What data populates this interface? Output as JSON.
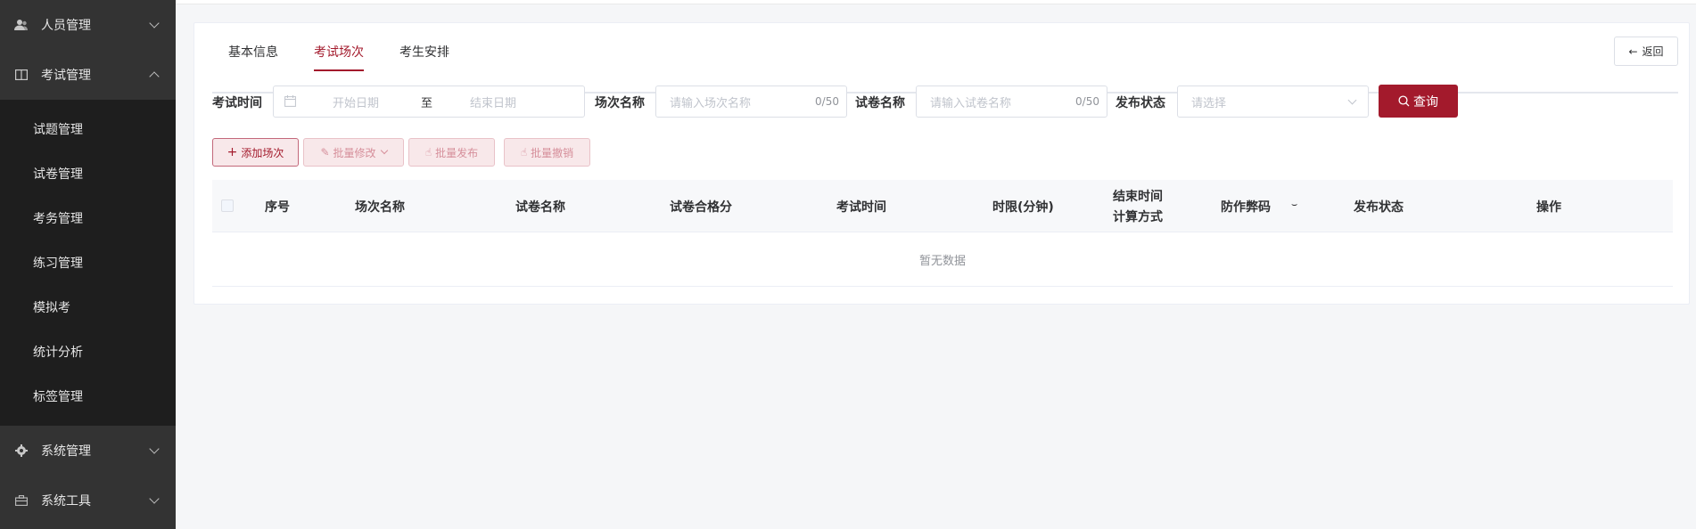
{
  "sidebar": {
    "menus": [
      {
        "label": "人员管理",
        "icon": "user-group-icon",
        "expanded": false
      },
      {
        "label": "考试管理",
        "icon": "book-icon",
        "expanded": true
      },
      {
        "label": "系统管理",
        "icon": "gear-icon",
        "expanded": false
      },
      {
        "label": "系统工具",
        "icon": "toolbox-icon",
        "expanded": false
      }
    ],
    "exam_submenu": [
      "试题管理",
      "试卷管理",
      "考务管理",
      "练习管理",
      "模拟考",
      "统计分析",
      "标签管理"
    ]
  },
  "tabs": [
    "基本信息",
    "考试场次",
    "考生安排"
  ],
  "active_tab": 1,
  "back_label": "返回",
  "filters": {
    "exam_time_label": "考试时间",
    "start_placeholder": "开始日期",
    "range_sep": "至",
    "end_placeholder": "结束日期",
    "session_name_label": "场次名称",
    "session_name_placeholder": "请输入场次名称",
    "session_name_count": "0/50",
    "paper_name_label": "试卷名称",
    "paper_name_placeholder": "请输入试卷名称",
    "paper_name_count": "0/50",
    "publish_status_label": "发布状态",
    "publish_status_placeholder": "请选择",
    "search_label": "查询"
  },
  "actions": {
    "add": "添加场次",
    "batch_edit": "批量修改",
    "batch_publish": "批量发布",
    "batch_revoke": "批量撤销"
  },
  "table": {
    "columns": [
      "序号",
      "场次名称",
      "试卷名称",
      "试卷合格分",
      "考试时间",
      "时限(分钟)",
      "结束时间",
      "计算方式",
      "防作弊码",
      "发布状态",
      "操作"
    ],
    "empty_text": "暂无数据"
  },
  "colors": {
    "accent": "#a31a2c",
    "sidebar_bg": "#333333",
    "submenu_bg": "#1e1e1e"
  }
}
